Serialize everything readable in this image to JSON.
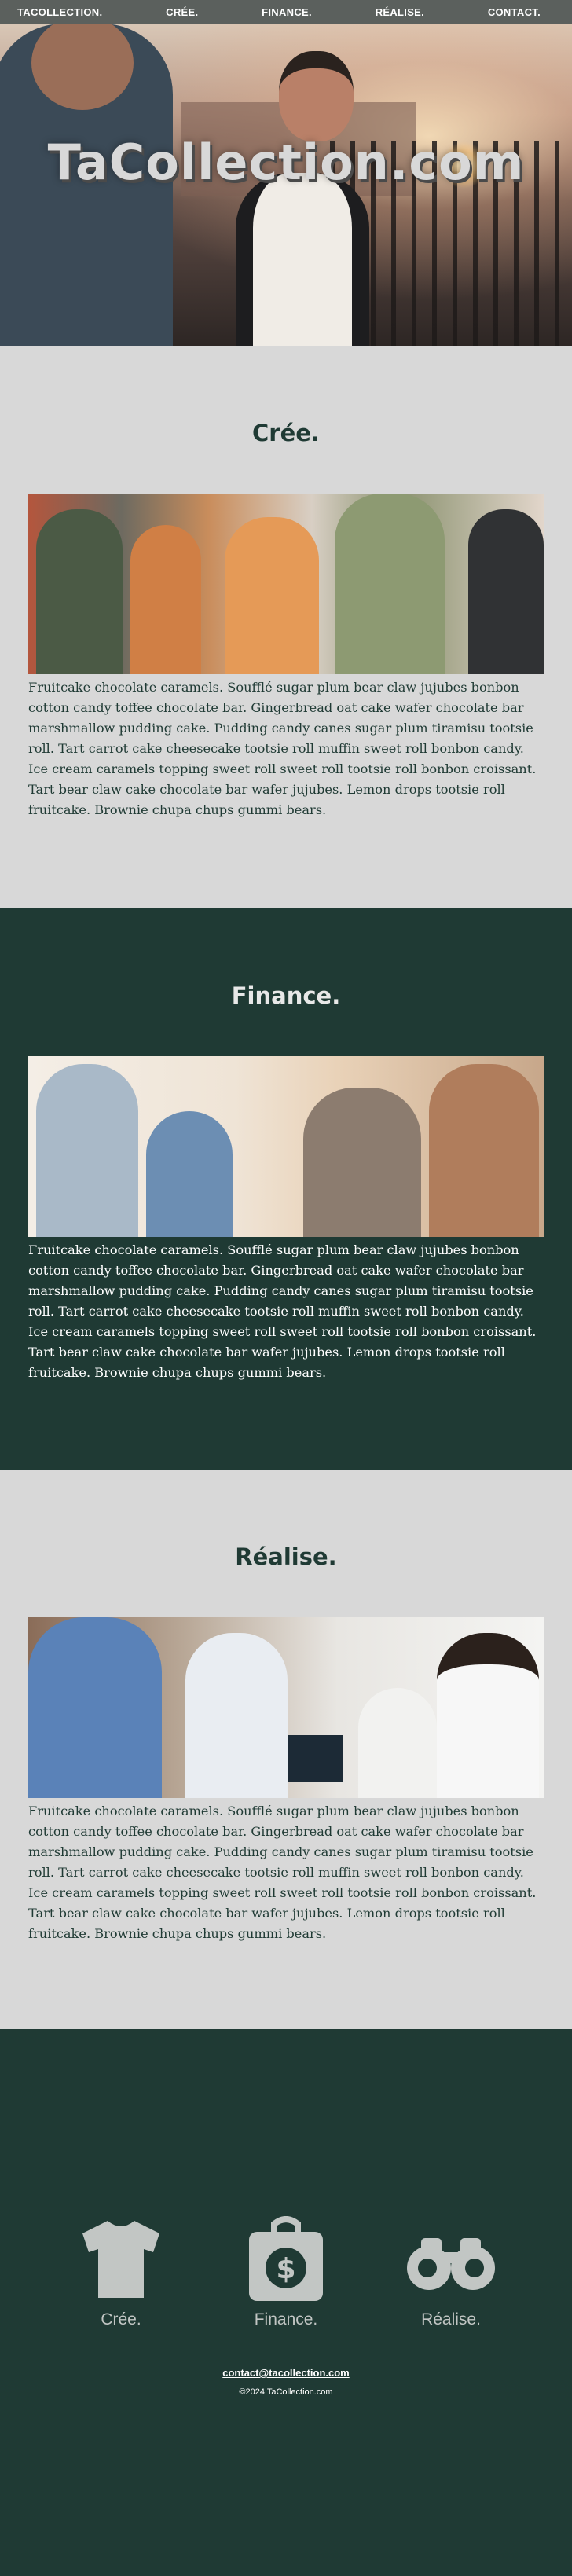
{
  "nav": {
    "items": [
      "TACOLLECTION.",
      "CRÉE.",
      "FINANCE.",
      "RÉALISE.",
      "CONTACT."
    ]
  },
  "hero": {
    "title": "TaCollection.com"
  },
  "sections": [
    {
      "title": "Crée.",
      "text": "Fruitcake chocolate caramels. Soufflé sugar plum bear claw jujubes bonbon cotton candy toffee chocolate bar. Gingerbread oat cake wafer chocolate bar marshmallow pudding cake. Pudding candy canes sugar plum tiramisu tootsie roll. Tart carrot cake cheesecake tootsie roll muffin sweet roll bonbon candy. Ice cream caramels topping sweet roll sweet roll tootsie roll bonbon croissant. Tart bear claw cake chocolate bar wafer jujubes. Lemon drops tootsie roll fruitcake. Brownie chupa chups gummi bears."
    },
    {
      "title": "Finance.",
      "text": "Fruitcake chocolate caramels. Soufflé sugar plum bear claw jujubes bonbon cotton candy toffee chocolate bar. Gingerbread oat cake wafer chocolate bar marshmallow pudding cake. Pudding candy canes sugar plum tiramisu tootsie roll. Tart carrot cake cheesecake tootsie roll muffin sweet roll bonbon candy. Ice cream caramels topping sweet roll sweet roll tootsie roll bonbon croissant. Tart bear claw cake chocolate bar wafer jujubes. Lemon drops tootsie roll fruitcake. Brownie chupa chups gummi bears."
    },
    {
      "title": "Réalise.",
      "text": "Fruitcake chocolate caramels. Soufflé sugar plum bear claw jujubes bonbon cotton candy toffee chocolate bar. Gingerbread oat cake wafer chocolate bar marshmallow pudding cake. Pudding candy canes sugar plum tiramisu tootsie roll. Tart carrot cake cheesecake tootsie roll muffin sweet roll bonbon candy. Ice cream caramels topping sweet roll sweet roll tootsie roll bonbon croissant. Tart bear claw cake chocolate bar wafer jujubes. Lemon drops tootsie roll fruitcake. Brownie chupa chups gummi bears."
    }
  ],
  "footer": {
    "features": [
      {
        "label": "Crée.",
        "icon": "tshirt-icon"
      },
      {
        "label": "Finance.",
        "icon": "money-bag-icon"
      },
      {
        "label": "Réalise.",
        "icon": "binoculars-icon"
      }
    ],
    "contact": "contact@tacollection.com",
    "copyright": "©2024 TaCollection.com"
  },
  "colors": {
    "dark_green": "#1f3a34",
    "light_gray": "#d8d8d8",
    "nav_bg": "#5b605d"
  }
}
